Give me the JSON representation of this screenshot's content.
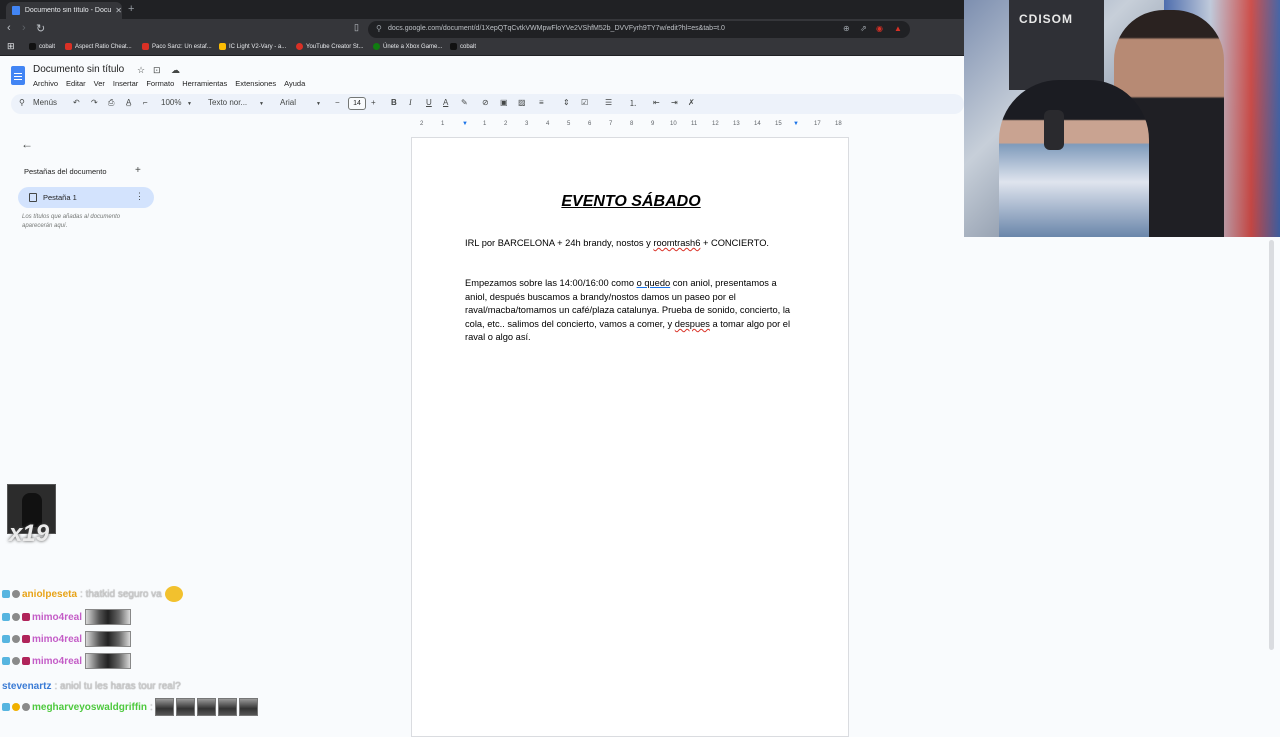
{
  "browser": {
    "tab_title": "Documento sin título - Docume",
    "url": "docs.google.com/document/d/1XepQTqCvtkVWMpwFloYVe2VShfM52b_DVVFyrh9TY7w/edit?hl=es&tab=t.0",
    "bookmarks": [
      {
        "label": "cobalt",
        "color": "#111111"
      },
      {
        "label": "Aspect Ratio Cheat...",
        "color": "#d93025"
      },
      {
        "label": "Paco Sanz: Un estaf...",
        "color": "#d93025"
      },
      {
        "label": "IC Light V2-Vary - a...",
        "color": "#fbbc04"
      },
      {
        "label": "YouTube Creator St...",
        "color": "#d93025"
      },
      {
        "label": "Únete a Xbox Game...",
        "color": "#107c10"
      },
      {
        "label": "cobalt",
        "color": "#111111"
      }
    ]
  },
  "docs": {
    "title": "Documento sin título",
    "menu": [
      "Archivo",
      "Editar",
      "Ver",
      "Insertar",
      "Formato",
      "Herramientas",
      "Extensiones",
      "Ayuda"
    ],
    "toolbar": {
      "menus_label": "Menús",
      "zoom": "100%",
      "style": "Texto nor...",
      "font": "Arial",
      "font_size": "14"
    },
    "ruler_ticks": [
      "2",
      "1",
      "1",
      "2",
      "3",
      "4",
      "5",
      "6",
      "7",
      "8",
      "9",
      "10",
      "11",
      "12",
      "13",
      "14",
      "15",
      "16",
      "17",
      "18"
    ],
    "sidebar": {
      "heading": "Pestañas del documento",
      "tab_label": "Pestaña 1",
      "note": "Los títulos que añadas al documento aparecerán aquí."
    },
    "document": {
      "heading": "EVENTO SÁBADO",
      "p1_a": "IRL por BARCELONA + 24h brandy, nostos y ",
      "p1_b": "roomtrash6",
      "p1_c": " + CONCIERTO.",
      "p2_a": "Empezamos sobre las  14:00/16:00 como ",
      "p2_b": "o quedo",
      "p2_c": " con aniol, presentamos a aniol, después buscamos a brandy/nostos damos un paseo por el raval/macba/tomamos un café/plaza catalunya. Prueba de sonido, concierto, la cola, etc.. salimos del concierto, vamos a comer, y ",
      "p2_d": "despues",
      "p2_e": " a tomar algo por el raval o algo así."
    }
  },
  "stream": {
    "webcam_banner": "CDISOM",
    "combo_text": "x19",
    "chat": [
      {
        "user": "aniolpeseta",
        "user_color": "#e8a317",
        "message": ": thatkid seguro va"
      },
      {
        "user": "mimo4real",
        "user_color": "#c45dc7",
        "message": ""
      },
      {
        "user": "mimo4real",
        "user_color": "#c45dc7",
        "message": ""
      },
      {
        "user": "mimo4real",
        "user_color": "#c45dc7",
        "message": ""
      },
      {
        "user": "stevenartz",
        "user_color": "#3a7bd5",
        "message": ": aniol tu les haras tour real?"
      },
      {
        "user": "megharveyoswaldgriffin",
        "user_color": "#4ec93e",
        "message": ":"
      }
    ]
  }
}
